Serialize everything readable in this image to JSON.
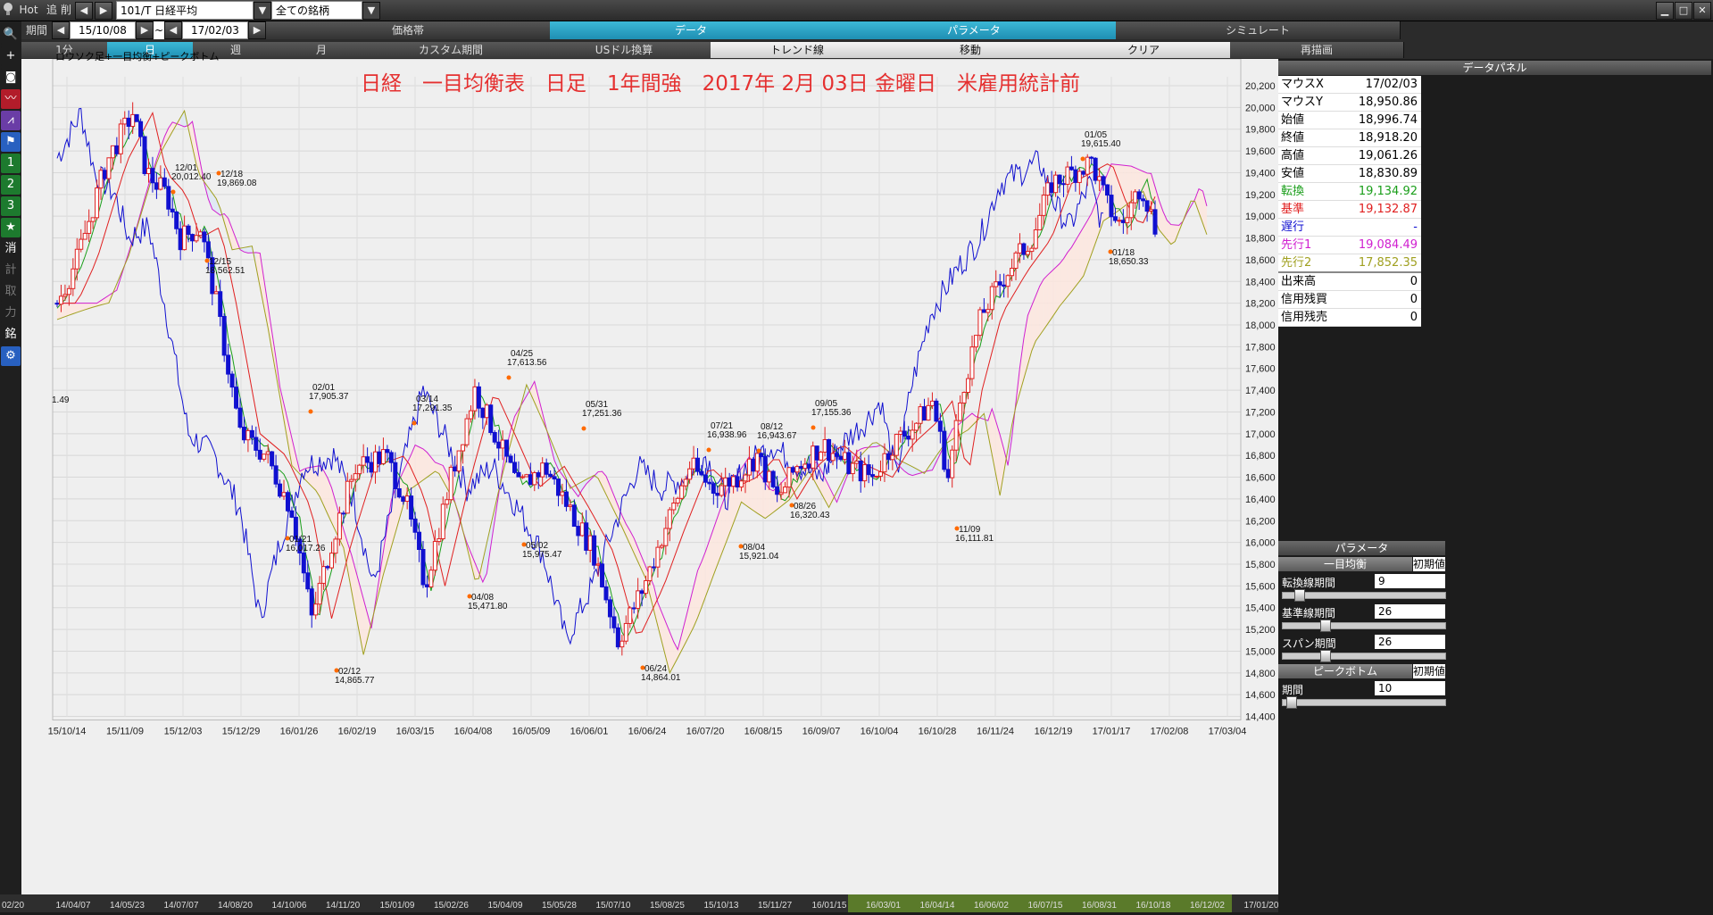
{
  "toolbar": {
    "hot": "Hot",
    "tsui": "追",
    "sakujo": "削",
    "symbol": "101/T 日経平均",
    "all_stocks": "全ての銘柄",
    "period_label": "期間",
    "date_from": "15/10/08",
    "tilde": "~",
    "date_to": "17/02/03"
  },
  "main_tabs": [
    "価格帯",
    "データ",
    "パラメータ",
    "シミュレート"
  ],
  "sub_tabs": [
    "1分",
    "日",
    "週",
    "月",
    "カスタム期間",
    "USドル換算",
    "トレンド線",
    "移動",
    "クリア",
    "再描画"
  ],
  "left_tools": [
    "search-icon",
    "plus-icon",
    "camera-icon",
    "line-chart-icon",
    "area-chart-icon",
    "flag-icon",
    "1",
    "2",
    "3",
    "star-icon",
    "消",
    "計",
    "取",
    "力",
    "銘",
    "gear-icon"
  ],
  "chart": {
    "legend": "ロウソク足+一目均衡+ピークボトム",
    "title": "日経　一目均衡表　日足　1年間強　2017年 2月 03日 金曜日　米雇用統計前",
    "title_color": "#e53030",
    "y_ticks": [
      "20,200",
      "20,000",
      "19,800",
      "19,600",
      "19,400",
      "19,200",
      "19,000",
      "18,800",
      "18,600",
      "18,400",
      "18,200",
      "18,000",
      "17,800",
      "17,600",
      "17,400",
      "17,200",
      "17,000",
      "16,800",
      "16,600",
      "16,400",
      "16,200",
      "16,000",
      "15,800",
      "15,600",
      "15,400",
      "15,200",
      "15,000",
      "14,800",
      "14,600",
      "14,400"
    ],
    "x_ticks": [
      "15/10/14",
      "15/11/09",
      "15/12/03",
      "15/12/29",
      "16/01/26",
      "16/02/19",
      "16/03/15",
      "16/04/08",
      "16/05/09",
      "16/06/01",
      "16/06/24",
      "16/07/20",
      "16/08/15",
      "16/09/07",
      "16/10/04",
      "16/10/28",
      "16/11/24",
      "16/12/19",
      "17/01/17",
      "17/02/08",
      "17/03/04"
    ],
    "peaks": [
      {
        "date": "12/01",
        "value": "20,012.40"
      },
      {
        "date": "12/18",
        "value": "19,869.08"
      },
      {
        "date": "12/15",
        "value": "18,562.51"
      },
      {
        "date": "02/01",
        "value": "17,905.37"
      },
      {
        "date": "01/21",
        "value": "16,017.26"
      },
      {
        "date": "02/12",
        "value": "14,865.77"
      },
      {
        "date": "03/14",
        "value": "17,291.35"
      },
      {
        "date": "04/08",
        "value": "15,471.80"
      },
      {
        "date": "04/25",
        "value": "17,613.56"
      },
      {
        "date": "05/02",
        "value": "15,975.47"
      },
      {
        "date": "05/31",
        "value": "17,251.36"
      },
      {
        "date": "06/24",
        "value": "14,864.01"
      },
      {
        "date": "07/21",
        "value": "16,938.96"
      },
      {
        "date": "08/12",
        "value": "16,943.67"
      },
      {
        "date": "08/04",
        "value": "15,921.04"
      },
      {
        "date": "08/26",
        "value": "16,320.43"
      },
      {
        "date": "09/05",
        "value": "17,155.36"
      },
      {
        "date": "11/09",
        "value": "16,111.81"
      },
      {
        "date": "01/05",
        "value": "19,615.40"
      },
      {
        "date": "01/18",
        "value": "18,650.33"
      }
    ],
    "edge_label": "1.49"
  },
  "data_panel": {
    "title": "データパネル",
    "rows": [
      {
        "k": "マウスX",
        "v": "17/02/03",
        "color": "#000000"
      },
      {
        "k": "マウスY",
        "v": "18,950.86",
        "color": "#000000"
      },
      {
        "k": "始値",
        "v": "18,996.74",
        "color": "#000000"
      },
      {
        "k": "終値",
        "v": "18,918.20",
        "color": "#000000"
      },
      {
        "k": "高値",
        "v": "19,061.26",
        "color": "#000000"
      },
      {
        "k": "安値",
        "v": "18,830.89",
        "color": "#000000"
      },
      {
        "k": "転換",
        "v": "19,134.92",
        "color": "#1a9e1a"
      },
      {
        "k": "基準",
        "v": "19,132.87",
        "color": "#e02020"
      },
      {
        "k": "遅行",
        "v": "-",
        "color": "#1010d0"
      },
      {
        "k": "先行1",
        "v": "19,084.49",
        "color": "#d020d0"
      },
      {
        "k": "先行2",
        "v": "17,852.35",
        "color": "#a0a020"
      },
      {
        "k": "出来高",
        "v": "0",
        "color": "#000000"
      },
      {
        "k": "信用残買",
        "v": "0",
        "color": "#000000"
      },
      {
        "k": "信用残売",
        "v": "0",
        "color": "#000000"
      }
    ]
  },
  "param_panel": {
    "title": "パラメータ",
    "ichimoku": "一目均衡",
    "init": "初期値",
    "tenkan_label": "転換線期間",
    "tenkan_value": "9",
    "tenkan_level": 0.08,
    "kijun_label": "基準線期間",
    "kijun_value": "26",
    "kijun_level": 0.25,
    "span_label": "スパン期間",
    "span_value": "26",
    "span_level": 0.25,
    "peak_title": "ピークボトム",
    "peak_init": "初期値",
    "period_label": "期間",
    "period_value": "10",
    "period_level": 0.03
  },
  "bottom": {
    "dates": [
      "02/20",
      "14/04/07",
      "14/05/23",
      "14/07/07",
      "14/08/20",
      "14/10/06",
      "14/11/20",
      "15/01/09",
      "15/02/26",
      "15/04/09",
      "15/05/28",
      "15/07/10",
      "15/08/25",
      "15/10/13",
      "15/11/27",
      "16/01/15",
      "16/03/01",
      "16/04/14",
      "16/06/02",
      "16/07/15",
      "16/08/31",
      "16/10/18",
      "16/12/02",
      "17/01/20"
    ]
  },
  "colors": {
    "accent": "#2aa7cc",
    "kumo_up": "#fde6de",
    "kumo_down": "#dde8f5"
  }
}
